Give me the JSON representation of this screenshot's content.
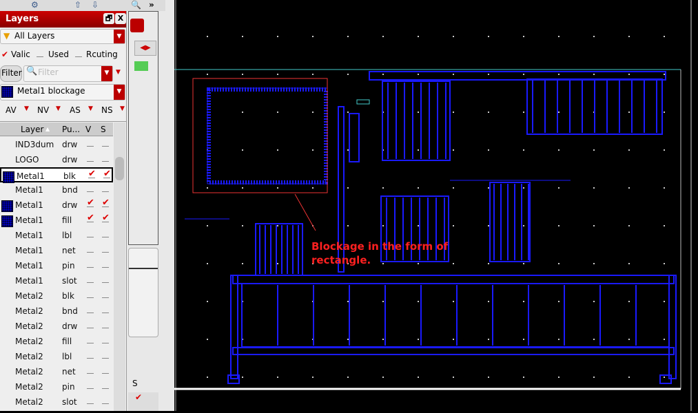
{
  "toolbar": {
    "more": "»"
  },
  "panel": {
    "title": "Layers",
    "float_btn": "🗗",
    "close_btn": "X",
    "layer_set": "All Layers",
    "checks": [
      {
        "label": "Valic",
        "checked": true
      },
      {
        "label": "Used",
        "checked": false
      },
      {
        "label": "Rcuting",
        "checked": false
      }
    ],
    "filter_button": "Filter",
    "filter_placeholder": "Filter",
    "current_layer": "Metal1 blockage",
    "vis_buttons": [
      "AV",
      "NV",
      "AS",
      "NS"
    ],
    "columns": [
      "Layer",
      "Pu...",
      "V",
      "S"
    ],
    "rows": [
      {
        "layer": "IND3dum",
        "purpose": "drw",
        "v": false,
        "s": false,
        "swatch": false
      },
      {
        "layer": "LOGO",
        "purpose": "drw",
        "v": false,
        "s": false,
        "swatch": false
      },
      {
        "layer": "Metal1",
        "purpose": "blk",
        "v": true,
        "s": true,
        "swatch": true,
        "selected": true
      },
      {
        "layer": "Metal1",
        "purpose": "bnd",
        "v": false,
        "s": false,
        "swatch": false
      },
      {
        "layer": "Metal1",
        "purpose": "drw",
        "v": true,
        "s": true,
        "swatch": true
      },
      {
        "layer": "Metal1",
        "purpose": "fill",
        "v": true,
        "s": true,
        "swatch": true
      },
      {
        "layer": "Metal1",
        "purpose": "lbl",
        "v": false,
        "s": false,
        "swatch": false
      },
      {
        "layer": "Metal1",
        "purpose": "net",
        "v": false,
        "s": false,
        "swatch": false
      },
      {
        "layer": "Metal1",
        "purpose": "pin",
        "v": false,
        "s": false,
        "swatch": false
      },
      {
        "layer": "Metal1",
        "purpose": "slot",
        "v": false,
        "s": false,
        "swatch": false
      },
      {
        "layer": "Metal2",
        "purpose": "blk",
        "v": false,
        "s": false,
        "swatch": false
      },
      {
        "layer": "Metal2",
        "purpose": "bnd",
        "v": false,
        "s": false,
        "swatch": false
      },
      {
        "layer": "Metal2",
        "purpose": "drw",
        "v": false,
        "s": false,
        "swatch": false
      },
      {
        "layer": "Metal2",
        "purpose": "fill",
        "v": false,
        "s": false,
        "swatch": false
      },
      {
        "layer": "Metal2",
        "purpose": "lbl",
        "v": false,
        "s": false,
        "swatch": false
      },
      {
        "layer": "Metal2",
        "purpose": "net",
        "v": false,
        "s": false,
        "swatch": false
      },
      {
        "layer": "Metal2",
        "purpose": "pin",
        "v": false,
        "s": false,
        "swatch": false
      },
      {
        "layer": "Metal2",
        "purpose": "slot",
        "v": false,
        "s": false,
        "swatch": false
      }
    ]
  },
  "side2": {
    "col": "S"
  },
  "canvas": {
    "annotation": "Blockage in the form of rectangle."
  }
}
